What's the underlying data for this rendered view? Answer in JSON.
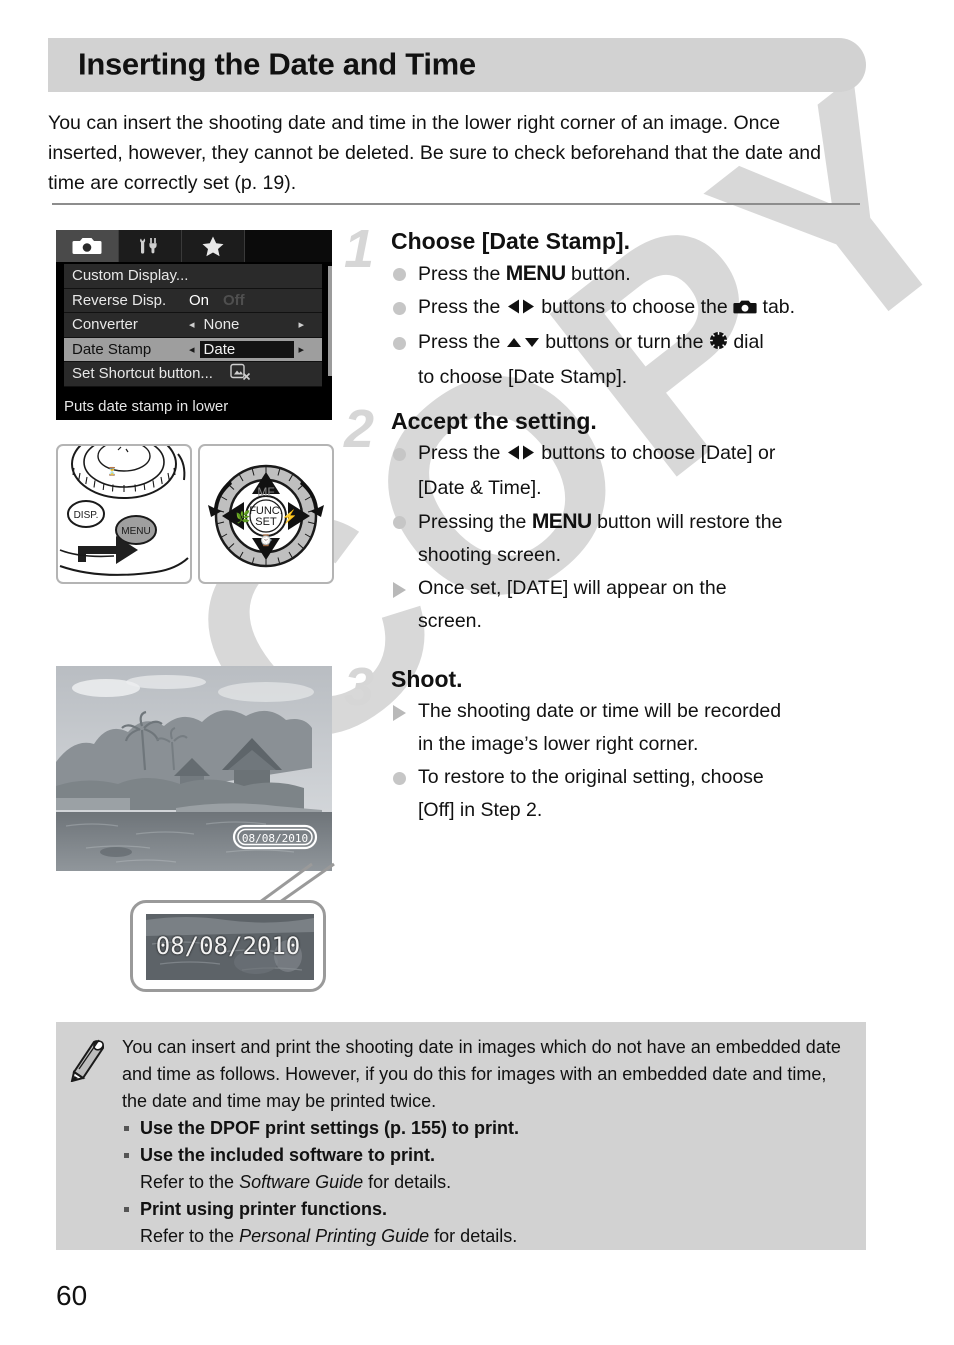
{
  "page": {
    "number": "60",
    "watermark": "COPY"
  },
  "header": {
    "title": "Inserting the Date and Time"
  },
  "intro": {
    "text": "You can insert the shooting date and time in the lower right corner of an image. Once inserted, however, they cannot be deleted. Be sure to check beforehand that the date and time are correctly set (p. 19)."
  },
  "lcd_menu": {
    "tabs": [
      {
        "icon": "camera-icon",
        "active": true
      },
      {
        "icon": "wrench-tools-icon",
        "active": false
      },
      {
        "icon": "star-icon",
        "active": false
      }
    ],
    "rows": [
      {
        "label": "Custom Display...",
        "value": "",
        "type": "submenu",
        "selected": false
      },
      {
        "label": "Reverse Disp.",
        "on": "On",
        "off": "Off",
        "type": "onoff",
        "selected": false
      },
      {
        "label": "Converter",
        "value": "None",
        "type": "stepper",
        "selected": false
      },
      {
        "label": "Date Stamp",
        "value": "Date",
        "type": "stepper",
        "selected": true
      },
      {
        "label": "Set Shortcut button...",
        "value": "",
        "type": "submenu-icon",
        "selected": false
      }
    ],
    "hint": "Puts date stamp in lower",
    "left_arrow": "◂",
    "right_arrow": "▸"
  },
  "diagrams": {
    "menu_button": {
      "name": "menu-button-diagram",
      "disp_label": "DISP.",
      "menu_label": "MENU"
    },
    "control_dial": {
      "name": "control-dial-diagram",
      "mf_label": "MF",
      "func_label": "FUNC.",
      "set_label": "SET"
    }
  },
  "sample_photo": {
    "name": "sample-photo-with-date-stamp",
    "date_stamp": "08/08/2010"
  },
  "callout": {
    "name": "date-stamp-zoom-callout",
    "date_stamp": "08/08/2010"
  },
  "steps": [
    {
      "number": "1",
      "title": "Choose [Date Stamp].",
      "lines": [
        {
          "bullet": "dot",
          "parts": [
            {
              "t": "text",
              "v": "Press the "
            },
            {
              "t": "menu",
              "v": "MENU"
            },
            {
              "t": "text",
              "v": " button."
            }
          ]
        },
        {
          "bullet": "dot",
          "parts": [
            {
              "t": "text",
              "v": "Press the "
            },
            {
              "t": "icon",
              "v": "left-right-arrows-icon"
            },
            {
              "t": "text",
              "v": " buttons to choose the "
            },
            {
              "t": "icon",
              "v": "camera-icon"
            },
            {
              "t": "text",
              "v": " tab."
            }
          ]
        },
        {
          "bullet": "dot",
          "parts": [
            {
              "t": "text",
              "v": "Press the "
            },
            {
              "t": "icon",
              "v": "up-down-arrows-icon"
            },
            {
              "t": "text",
              "v": " buttons or turn the "
            },
            {
              "t": "icon",
              "v": "control-dial-icon"
            },
            {
              "t": "text",
              "v": " dial"
            }
          ]
        },
        {
          "bullet": "none",
          "parts": [
            {
              "t": "text",
              "v": "to choose [Date Stamp]."
            }
          ]
        }
      ]
    },
    {
      "number": "2",
      "title": "Accept the setting.",
      "lines": [
        {
          "bullet": "dot",
          "parts": [
            {
              "t": "text",
              "v": "Press the "
            },
            {
              "t": "icon",
              "v": "left-right-arrows-icon"
            },
            {
              "t": "text",
              "v": " buttons to choose [Date] or"
            }
          ]
        },
        {
          "bullet": "none",
          "parts": [
            {
              "t": "text",
              "v": "[Date & Time]."
            }
          ]
        },
        {
          "bullet": "dot",
          "parts": [
            {
              "t": "text",
              "v": "Pressing the "
            },
            {
              "t": "menu",
              "v": "MENU"
            },
            {
              "t": "text",
              "v": " button will restore the"
            }
          ]
        },
        {
          "bullet": "none",
          "parts": [
            {
              "t": "text",
              "v": "shooting screen."
            }
          ]
        },
        {
          "bullet": "triangle",
          "parts": [
            {
              "t": "text",
              "v": "Once set, [DATE] will appear on the"
            }
          ]
        },
        {
          "bullet": "none",
          "parts": [
            {
              "t": "text",
              "v": "screen."
            }
          ]
        }
      ]
    },
    {
      "number": "3",
      "title": "Shoot.",
      "lines": [
        {
          "bullet": "triangle",
          "parts": [
            {
              "t": "text",
              "v": "The shooting date or time will be recorded"
            }
          ]
        },
        {
          "bullet": "none",
          "parts": [
            {
              "t": "text",
              "v": "in the image’s lower right corner."
            }
          ]
        },
        {
          "bullet": "dot",
          "parts": [
            {
              "t": "text",
              "v": "To restore to the original setting, choose"
            }
          ]
        },
        {
          "bullet": "none",
          "parts": [
            {
              "t": "text",
              "v": "[Off] in Step 2."
            }
          ]
        }
      ]
    }
  ],
  "note": {
    "icon": "pencil-icon",
    "paragraph": "You can insert and print the shooting date in images which do not have an embedded date and time as follows. However, if you do this for images with an embedded date and time, the date and time may be printed twice.",
    "items": [
      {
        "bold": "Use the DPOF print settings (p. 155) to print.",
        "sub_prefix": "",
        "sub_italic": "",
        "sub_suffix": ""
      },
      {
        "bold": "Use the included software to print.",
        "sub_prefix": "Refer to the ",
        "sub_italic": "Software Guide",
        "sub_suffix": " for details."
      },
      {
        "bold": "Print using printer functions.",
        "sub_prefix": "Refer to the ",
        "sub_italic": "Personal Printing Guide",
        "sub_suffix": " for details."
      }
    ]
  }
}
